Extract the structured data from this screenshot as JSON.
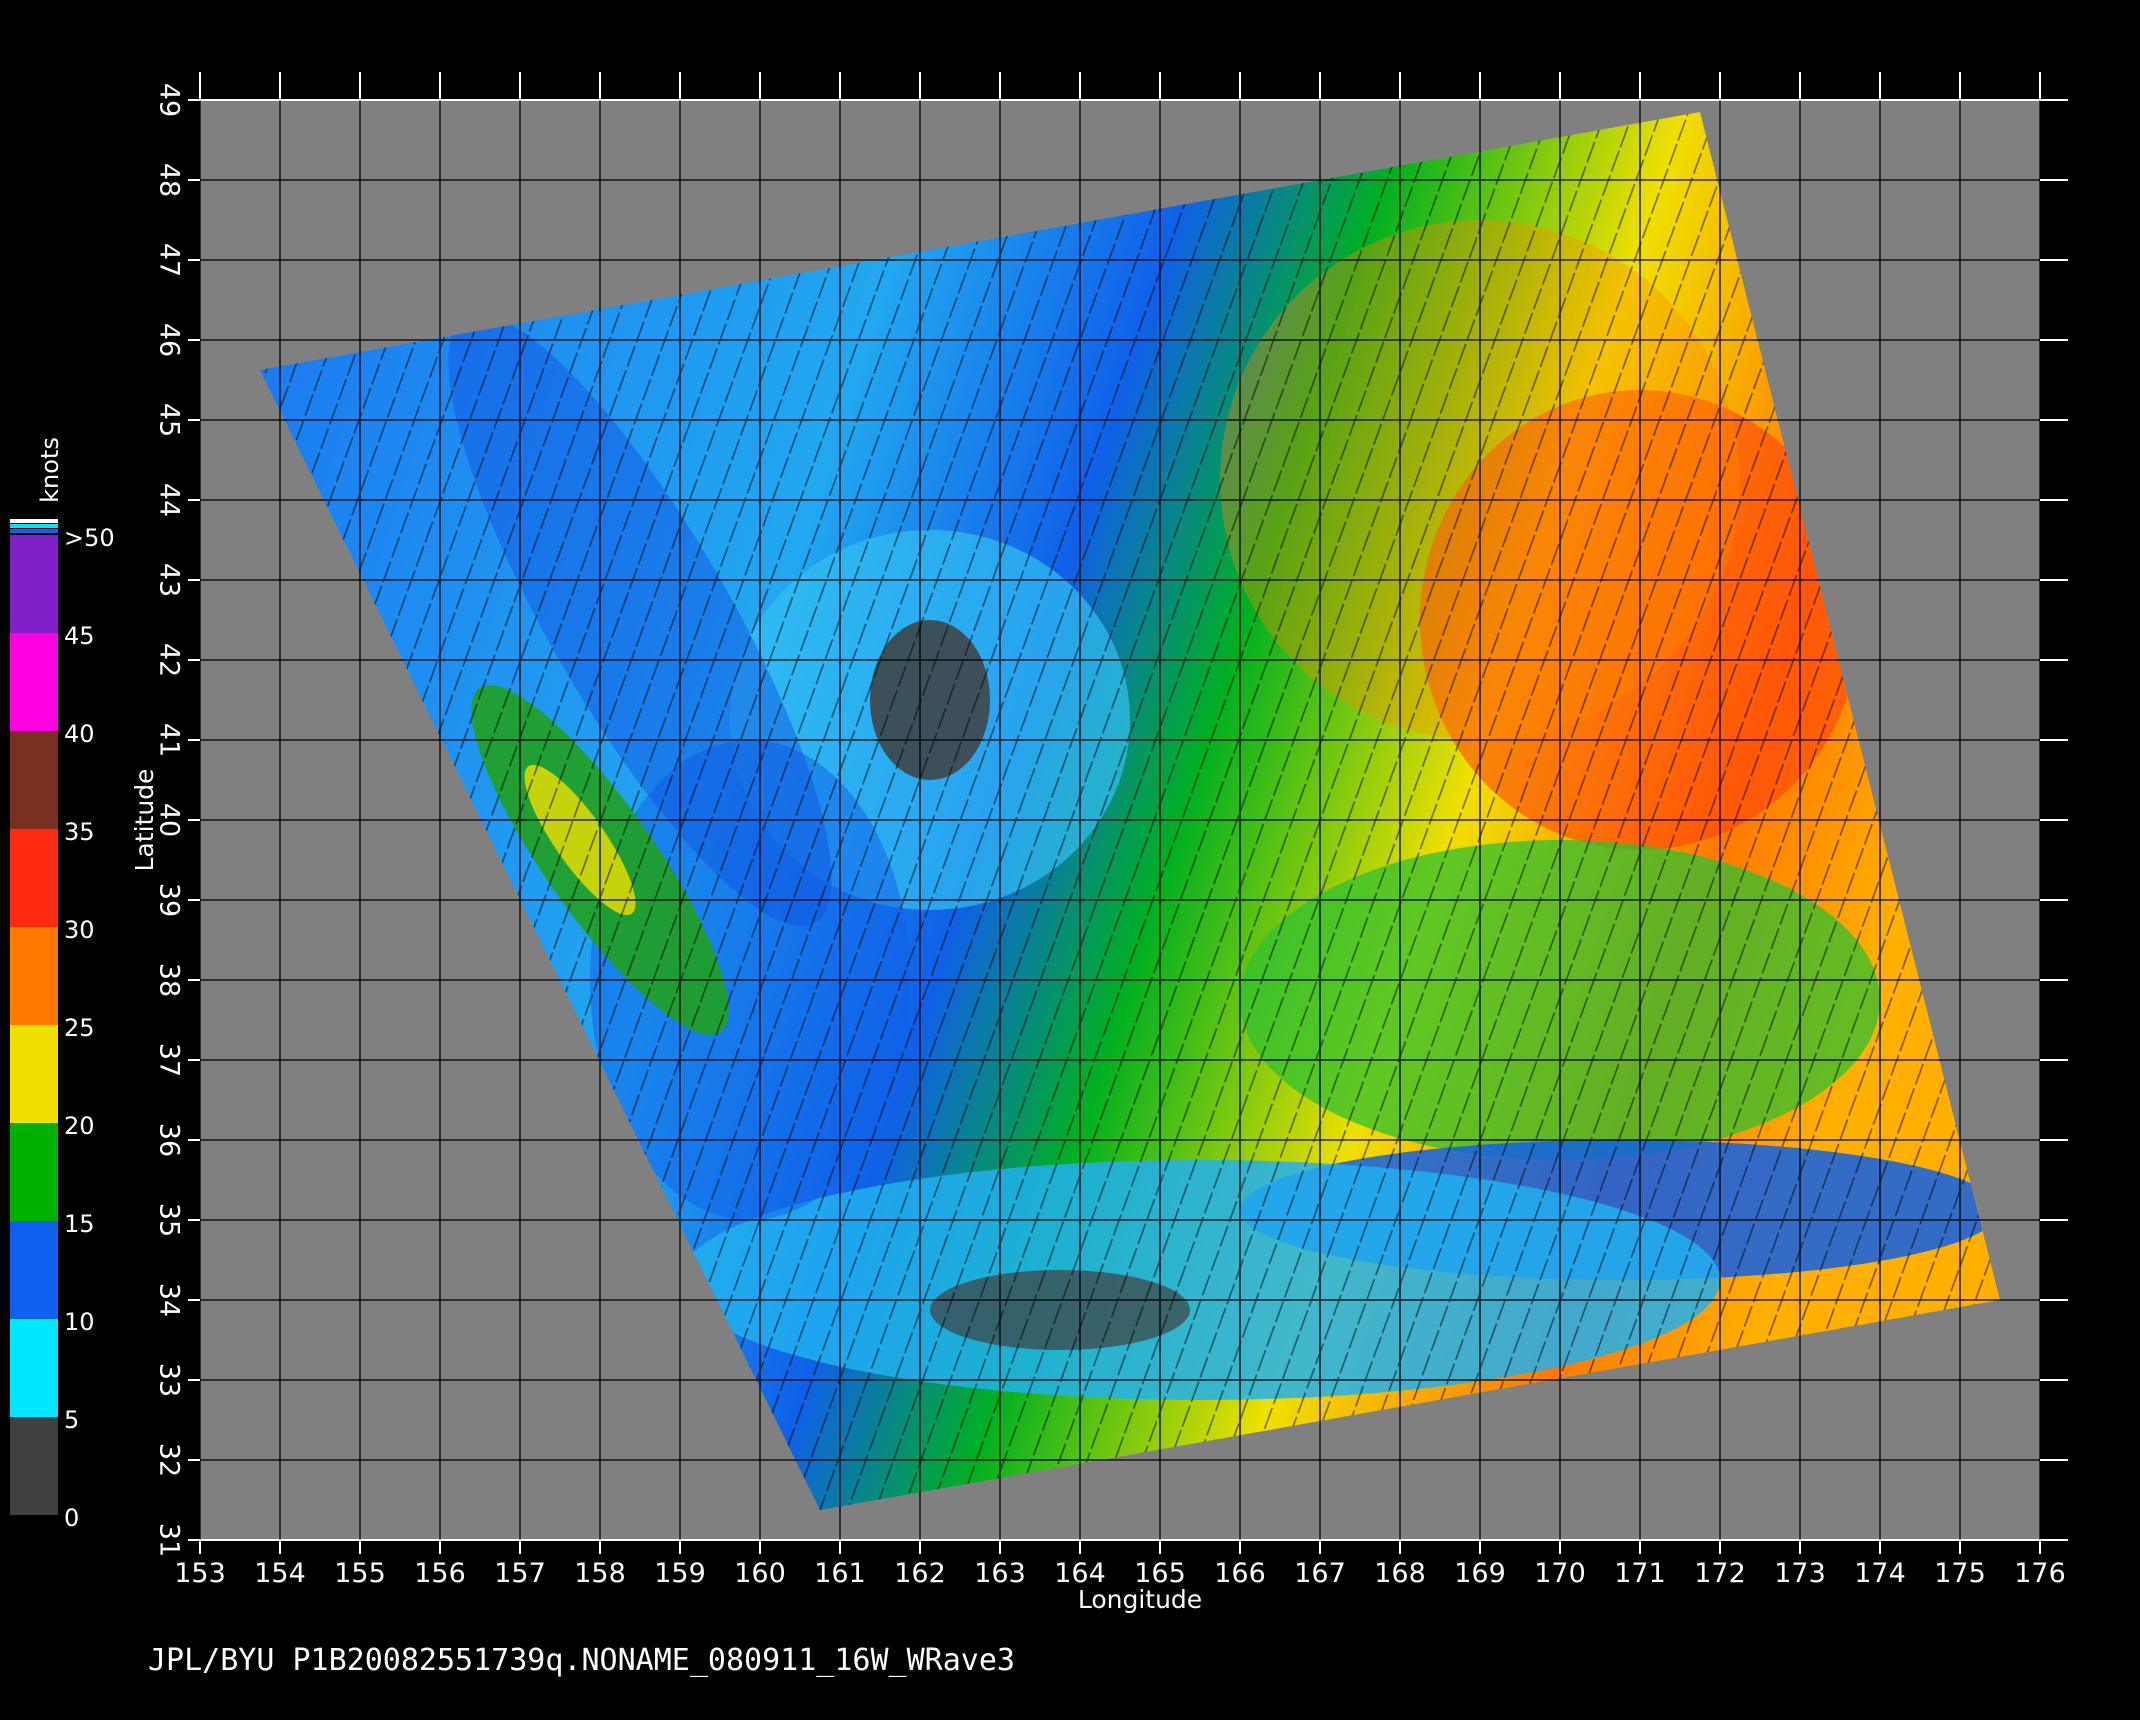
{
  "map": {
    "x_axis_label": "Longitude",
    "y_axis_label": "Latitude",
    "x_ticks": [
      "153",
      "154",
      "155",
      "156",
      "157",
      "158",
      "159",
      "160",
      "161",
      "162",
      "163",
      "164",
      "165",
      "166",
      "167",
      "168",
      "169",
      "170",
      "171",
      "172",
      "173",
      "174",
      "175",
      "176"
    ],
    "y_ticks": [
      "31",
      "32",
      "33",
      "34",
      "35",
      "36",
      "37",
      "38",
      "39",
      "40",
      "41",
      "42",
      "43",
      "44",
      "45",
      "46",
      "47",
      "48",
      "49"
    ],
    "x_range": [
      153,
      176
    ],
    "y_range": [
      31,
      49
    ],
    "grid": true,
    "background_color": "#808080",
    "colorbar": {
      "title": "knots",
      "labels": [
        "0",
        "5",
        "10",
        "15",
        "20",
        "25",
        "30",
        "35",
        "40",
        "45",
        ">50"
      ],
      "bands": [
        {
          "from": 0,
          "to": 5,
          "color": "#404040"
        },
        {
          "from": 5,
          "to": 10,
          "color": "#00e8ff"
        },
        {
          "from": 10,
          "to": 15,
          "color": "#1060f0"
        },
        {
          "from": 15,
          "to": 20,
          "color": "#00b000"
        },
        {
          "from": 20,
          "to": 25,
          "color": "#f0e000"
        },
        {
          "from": 25,
          "to": 30,
          "color": "#ff7a00"
        },
        {
          "from": 30,
          "to": 35,
          "color": "#ff2a10"
        },
        {
          "from": 35,
          "to": 40,
          "color": "#7a3020"
        },
        {
          "from": 40,
          "to": 45,
          "color": "#ff00e0"
        },
        {
          "from": 45,
          "to": 50,
          "color": "#8020c8"
        }
      ]
    },
    "swath_regions": [
      {
        "name": "calm-center",
        "lon": 162.4,
        "lat": 41.4,
        "speed_band": "0-5"
      },
      {
        "name": "eastern-strong-winds",
        "lon": 172,
        "lat": 42.5,
        "speed_band": "25-35"
      },
      {
        "name": "western-green-band",
        "lon": 158.2,
        "lat": 39.5,
        "speed_band": "15-25"
      }
    ]
  },
  "caption": "JPL/BYU  P1B20082551739q.NONAME_080911_16W_WRave3"
}
